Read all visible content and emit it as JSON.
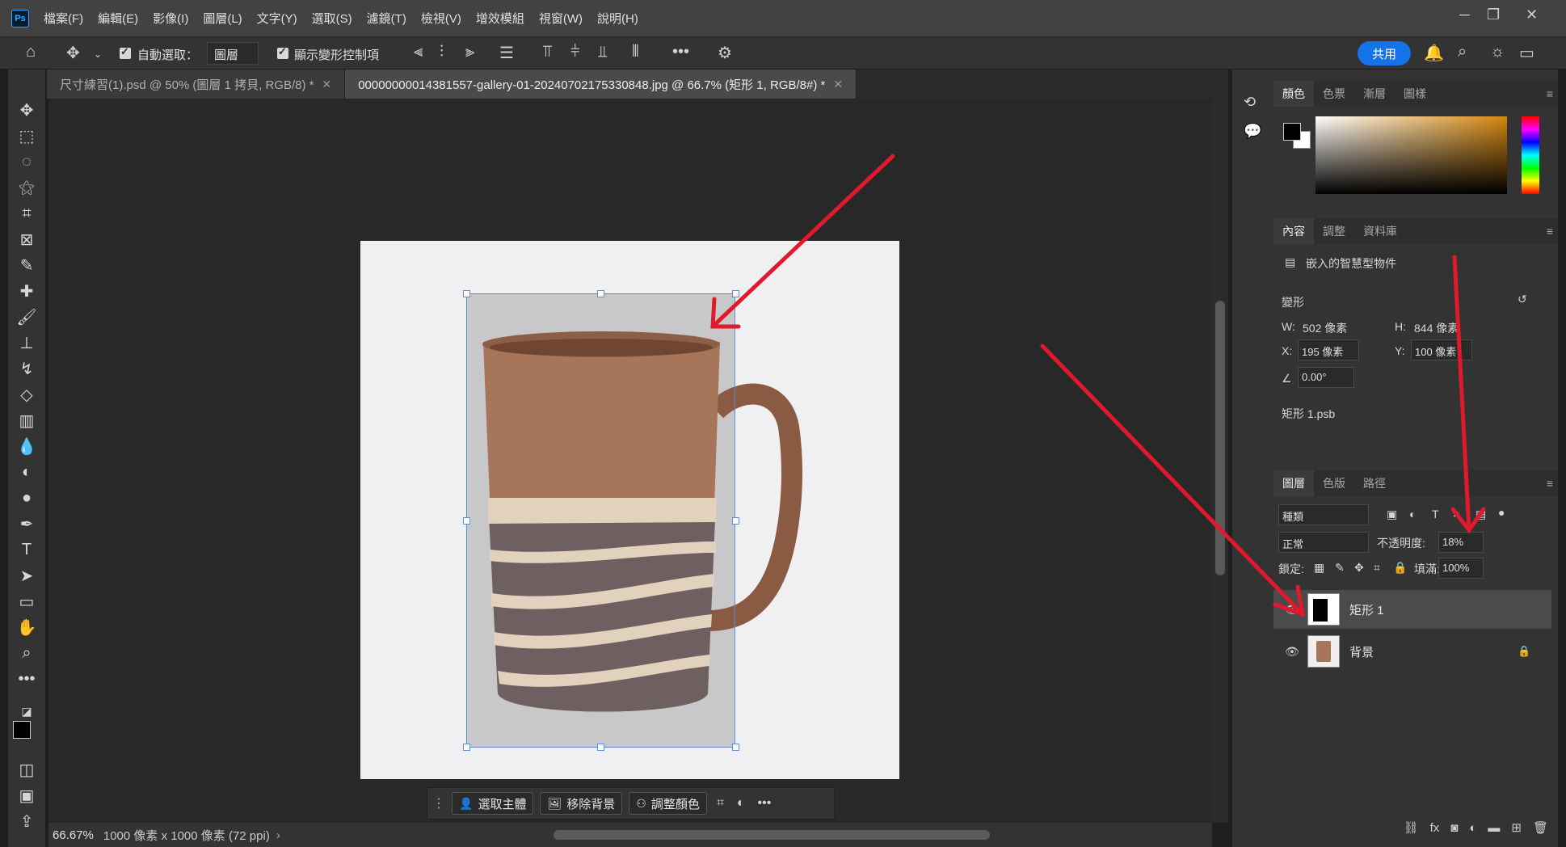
{
  "menubar": {
    "items": [
      "檔案(F)",
      "編輯(E)",
      "影像(I)",
      "圖層(L)",
      "文字(Y)",
      "選取(S)",
      "濾鏡(T)",
      "檢視(V)",
      "增效模組",
      "視窗(W)",
      "說明(H)"
    ],
    "app_logo": "Ps"
  },
  "options": {
    "auto_select_label": "自動選取：",
    "auto_select_value": "圖層",
    "show_transform_label": "顯示變形控制項",
    "share_label": "共用"
  },
  "tabs": [
    {
      "label": "尺寸練習(1).psd @ 50% (圖層 1 拷貝, RGB/8) *"
    },
    {
      "label": "00000000014381557-gallery-01-20240702175330848.jpg @ 66.7% (矩形 1, RGB/8#) *"
    }
  ],
  "context_bar": {
    "select_subject": "選取主體",
    "remove_bg": "移除背景",
    "adjust_color": "調整顏色"
  },
  "status": {
    "zoom": "66.67%",
    "doc_size": "1000 像素 x 1000 像素 (72 ppi)"
  },
  "color_panel": {
    "tabs": [
      "顏色",
      "色票",
      "漸層",
      "圖樣"
    ]
  },
  "properties_panel": {
    "tabs": [
      "內容",
      "調整",
      "資料庫"
    ],
    "object_type": "嵌入的智慧型物件",
    "section": "變形",
    "w_label": "W:",
    "w_value": "502 像素",
    "h_label": "H:",
    "h_value": "844 像素",
    "x_label": "X:",
    "x_value": "195 像素",
    "y_label": "Y:",
    "y_value": "100 像素",
    "angle_value": "0.00°",
    "file_name": "矩形 1.psb"
  },
  "layers_panel": {
    "tabs": [
      "圖層",
      "色版",
      "路徑"
    ],
    "filter_value": "種類",
    "blend_mode": "正常",
    "opacity_label": "不透明度:",
    "opacity_value": "18%",
    "lock_label": "鎖定:",
    "fill_label": "填滿:",
    "fill_value": "100%",
    "layers": [
      {
        "name": "矩形 1",
        "selected": true
      },
      {
        "name": "背景",
        "selected": false,
        "locked": true
      }
    ]
  },
  "colors": {
    "accent": "#1473e6",
    "annotation_arrow": "#e0192c",
    "selection": "#5b8fdc"
  }
}
